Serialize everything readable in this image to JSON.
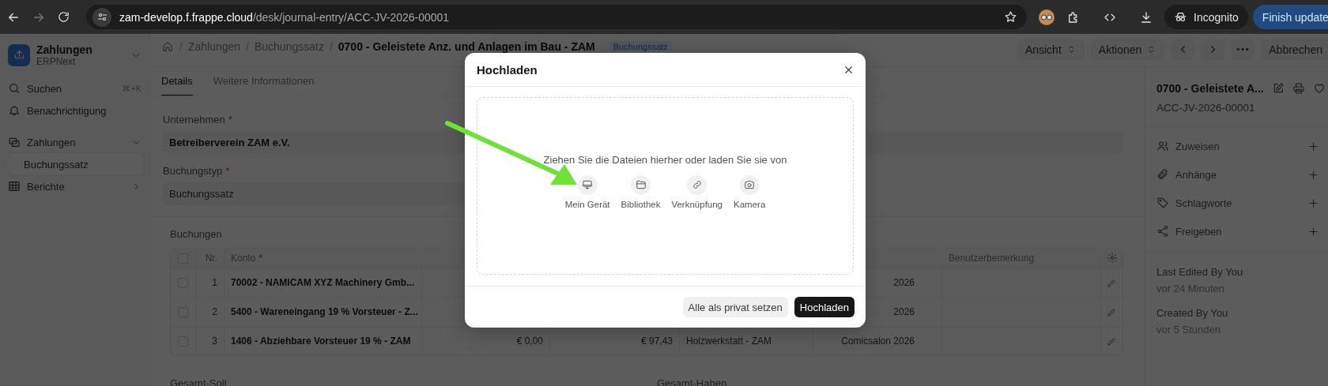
{
  "browser": {
    "url_host": "zam-develop.f.frappe.cloud",
    "url_path": "/desk/journal-entry/ACC-JV-2026-00001",
    "incognito_label": "Incognito",
    "update_button": "Finish update"
  },
  "sidebar": {
    "app_title": "Zahlungen",
    "app_subtitle": "ERPNext",
    "nav": [
      {
        "kind": "search",
        "label": "Suchen",
        "shortcut": "⌘+K"
      },
      {
        "kind": "notifications",
        "label": "Benachrichtigung"
      }
    ],
    "modules": [
      {
        "kind": "payments",
        "label": "Zahlungen",
        "expanded": true,
        "children": [
          {
            "label": "Buchungssatz",
            "selected": true
          }
        ]
      },
      {
        "kind": "reports",
        "label": "Berichte",
        "expanded": false
      }
    ]
  },
  "page_header": {
    "breadcrumb": [
      {
        "kind": "home"
      },
      {
        "kind": "separator",
        "text": "/"
      },
      {
        "kind": "link",
        "text": "Zahlungen"
      },
      {
        "kind": "separator",
        "text": "/"
      },
      {
        "kind": "link",
        "text": "Buchungssatz"
      },
      {
        "kind": "separator",
        "text": "/"
      },
      {
        "kind": "current",
        "text": "0700 - Geleistete Anz. und Anlagen im Bau - ZAM"
      }
    ],
    "status": "Buchungssatz",
    "actions": [
      {
        "kind": "dropdown",
        "label": "Ansicht"
      },
      {
        "kind": "dropdown",
        "label": "Aktionen"
      },
      {
        "kind": "prev"
      },
      {
        "kind": "next"
      },
      {
        "kind": "more"
      },
      {
        "kind": "button",
        "label": "Abbrechen"
      }
    ]
  },
  "tabs": [
    {
      "label": "Details",
      "selected": true
    },
    {
      "label": "Weitere Informationen",
      "selected": false
    }
  ],
  "fields": [
    {
      "kind": "link",
      "label": "Unternehmen",
      "required_mark": "*",
      "value": "Betreiberverein ZAM e.V."
    },
    {
      "kind": "select",
      "label": "Buchungstyp",
      "required_mark": "*",
      "value": "Buchungssatz"
    }
  ],
  "entries": {
    "title": "Buchungen",
    "header": {
      "checked": false,
      "nr": "Nr.",
      "account": "Konto",
      "account_mark": "*",
      "remark": "Benutzerbemerkung"
    },
    "rows": [
      {
        "checked": false,
        "nr": "1",
        "account": "70002 - NAMICAM XYZ Machinery Gmb...",
        "project": "2026"
      },
      {
        "checked": false,
        "nr": "2",
        "account": "5400 - Wareneingang 19 % Vorsteuer - Z...",
        "project": "2026"
      },
      {
        "checked": false,
        "nr": "3",
        "account": "1406 - Abziehbare Vorsteuer 19 % - ZAM",
        "debit": "€ 0,00",
        "credit": "€ 97,43",
        "cost_center": "Holzwerkstatt - ZAM",
        "project": "Comicsalon 2026"
      }
    ]
  },
  "totals": [
    "Gesamt-Soll",
    "Gesamt-Haben"
  ],
  "doc_panel": {
    "title": "0700 - Geleistete A...",
    "id": "ACC-JV-2026-00001",
    "actions": [
      {
        "kind": "assign",
        "label": "Zuweisen"
      },
      {
        "kind": "attachments",
        "label": "Anhänge"
      },
      {
        "kind": "tags",
        "label": "Schlagworte"
      },
      {
        "kind": "share",
        "label": "Freigeben"
      }
    ],
    "activity": [
      {
        "label": "Last Edited By You",
        "time": "vor 24 Minuten"
      },
      {
        "label": "Created By You",
        "time": "vor 5 Stunden"
      }
    ]
  },
  "upload_dialog": {
    "title": "Hochladen",
    "hint": "Ziehen Sie die Dateien hierher oder laden Sie sie von",
    "sources": [
      {
        "kind": "device",
        "label": "Mein Gerät"
      },
      {
        "kind": "library",
        "label": "Bibliothek"
      },
      {
        "kind": "link",
        "label": "Verknüpfung"
      },
      {
        "kind": "camera",
        "label": "Kamera"
      }
    ],
    "buttons": [
      {
        "kind": "secondary",
        "label": "Alle als privat setzen"
      },
      {
        "kind": "primary",
        "label": "Hochladen"
      }
    ]
  }
}
